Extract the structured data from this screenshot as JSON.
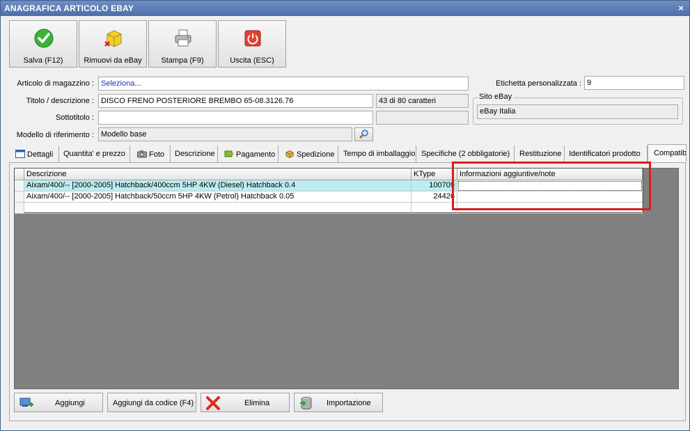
{
  "window": {
    "title": "ANAGRAFICA ARTICOLO EBAY",
    "close_glyph": "×"
  },
  "toolbar": [
    {
      "label": "Salva (F12)",
      "icon": "check-icon",
      "color": "#2e9e2e"
    },
    {
      "label": "Rimuovi da eBay",
      "icon": "box-remove-icon",
      "color": "#e8c21a"
    },
    {
      "label": "Stampa (F9)",
      "icon": "printer-icon",
      "color": "#9a9a9a"
    },
    {
      "label": "Uscita (ESC)",
      "icon": "power-icon",
      "color": "#d93a2b"
    }
  ],
  "form": {
    "articolo_label": "Articolo di magazzino :",
    "articolo_value": "Seleziona...",
    "titolo_label": "Titolo / descrizione :",
    "titolo_value": "DISCO FRENO POSTERIORE BREMBO 65-08.3126.76",
    "char_count": "43 di 80 caratteri",
    "sottotitolo_label": "Sottotitolo :",
    "sottotitolo_value": "",
    "modello_label": "Modello di riferimento :",
    "modello_value": "Modello base",
    "etichetta_label": "Etichetta personalizzata :",
    "etichetta_value": "9",
    "sito_label": "Sito eBay",
    "sito_value": "eBay Italia"
  },
  "tabs": [
    {
      "label": "Dettagli",
      "icon": "window-icon"
    },
    {
      "label": "Quantita' e prezzo",
      "icon": ""
    },
    {
      "label": "Foto",
      "icon": "camera-icon"
    },
    {
      "label": "Descrizione",
      "icon": ""
    },
    {
      "label": "Pagamento",
      "icon": "payment-icon"
    },
    {
      "label": "Spedizione",
      "icon": "shipping-icon"
    },
    {
      "label": "Tempo di imballaggio",
      "icon": ""
    },
    {
      "label": "Specifiche (2 obbligatorie)",
      "icon": ""
    },
    {
      "label": "Restituzione",
      "icon": ""
    },
    {
      "label": "Identificatori prodotto",
      "icon": ""
    },
    {
      "label": "Compatibilità",
      "icon": ""
    }
  ],
  "grid": {
    "columns": [
      "Descrizione",
      "KType",
      "Informazioni aggiuntive/note"
    ],
    "rows": [
      {
        "descrizione": "Aixam/400/-- [2000-2005] Hatchback/400ccm 5HP 4KW (Diesel) Hatchback 0.4",
        "ktype": "100709",
        "note": ""
      },
      {
        "descrizione": "Aixam/400/-- [2000-2005] Hatchback/50ccm 5HP 4KW (Petrol) Hatchback 0.05",
        "ktype": "24426",
        "note": ""
      }
    ]
  },
  "bottom_buttons": [
    {
      "label": "Aggiungi",
      "icon": "add-icon"
    },
    {
      "label": "Aggiungi da codice (F4)",
      "icon": ""
    },
    {
      "label": "Elimina",
      "icon": "delete-icon"
    },
    {
      "label": "Importazione",
      "icon": "import-icon"
    }
  ]
}
